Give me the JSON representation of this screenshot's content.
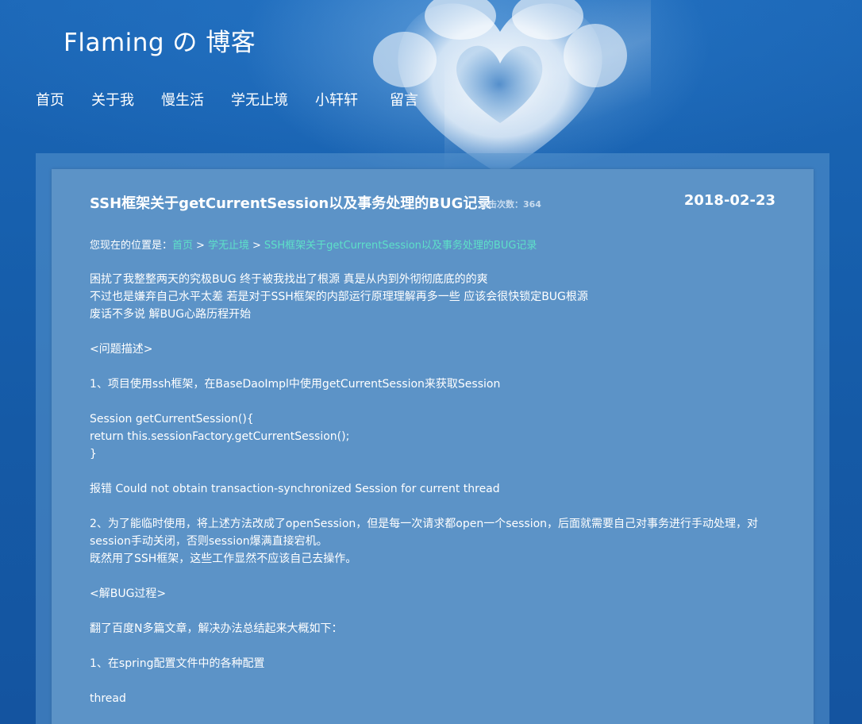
{
  "site": {
    "brand": "Flaming の 博客"
  },
  "nav": {
    "items": [
      "首页",
      "关于我",
      "慢生活",
      "学无止境",
      "小轩轩",
      "留言"
    ]
  },
  "post": {
    "title": "SSH框架关于getCurrentSession以及事务处理的BUG记录",
    "click_count": "点击次数：364",
    "date": "2018-02-23"
  },
  "breadcrumb": {
    "prefix": "您现在的位置是：",
    "items": [
      "首页",
      "学无止境",
      "SSH框架关于getCurrentSession以及事务处理的BUG记录"
    ],
    "separator": ">"
  },
  "article": {
    "lines": [
      "困扰了我整整两天的究极BUG 终于被我找出了根源 真是从内到外彻彻底底的的爽",
      "不过也是嫌弃自己水平太差 若是对于SSH框架的内部运行原理理解再多一些 应该会很快锁定BUG根源",
      "废话不多说 解BUG心路历程开始",
      "",
      "<问题描述>",
      "",
      "1、项目使用ssh框架，在BaseDaoImpl中使用getCurrentSession来获取Session",
      "",
      "Session getCurrentSession(){",
      "return this.sessionFactory.getCurrentSession();",
      "}",
      "",
      "报错 Could not obtain transaction-synchronized Session for current thread",
      "",
      "2、为了能临时使用，将上述方法改成了openSession，但是每一次请求都open一个session，后面就需要自己对事务进行手动处理，对",
      "session手动关闭，否则session爆满直接宕机。",
      "既然用了SSH框架，这些工作显然不应该自己去操作。",
      "",
      "<解BUG过程>",
      "",
      "翻了百度N多篇文章，解决办法总结起来大概如下：",
      "",
      "1、在spring配置文件中的各种配置",
      "",
      "thread"
    ]
  },
  "colors": {
    "background": "#1a5fae",
    "panel": "#5c93c7",
    "link": "#5ee0c8",
    "text": "#ffffff"
  }
}
